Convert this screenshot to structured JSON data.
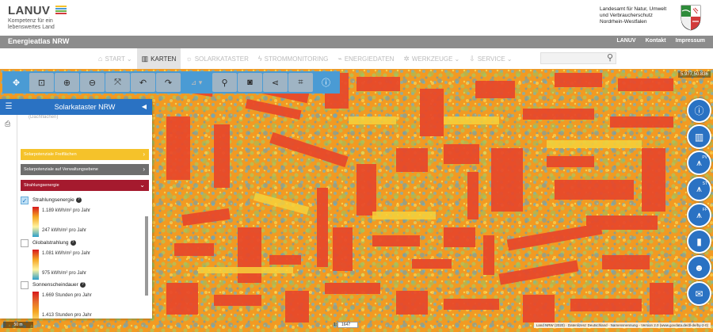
{
  "header": {
    "logo_title": "LANUV",
    "logo_subtitle": "Kompetenz für ein lebenswertes Land",
    "logo_stripe_colors": [
      "#f5c22a",
      "#4a9bd4",
      "#6ab04c",
      "#d23b3b"
    ],
    "agency_name": "Landesamt für Natur, Umwelt und Verbraucherschutz Nordrhein-Westfalen",
    "crest_icon": "nrw-crest-icon"
  },
  "greybar": {
    "site_title": "Energieatlas NRW",
    "links": [
      "LANUV",
      "Kontakt",
      "Impressum"
    ]
  },
  "nav": {
    "items": [
      {
        "label": "START",
        "icon": "home-icon",
        "glyph": "⌂",
        "dropdown": true,
        "active": false
      },
      {
        "label": "KARTEN",
        "icon": "map-icon",
        "glyph": "▥",
        "dropdown": false,
        "active": true
      },
      {
        "label": "SOLARKATASTER",
        "icon": "sun-icon",
        "glyph": "☼",
        "dropdown": false,
        "active": false
      },
      {
        "label": "STROMMONITORING",
        "icon": "bolt-icon",
        "glyph": "ϟ",
        "dropdown": false,
        "active": false
      },
      {
        "label": "ENERGIEDATEN",
        "icon": "chart-icon",
        "glyph": "⌁",
        "dropdown": false,
        "active": false
      },
      {
        "label": "WERKZEUGE",
        "icon": "cogs-icon",
        "glyph": "✲",
        "dropdown": true,
        "active": false
      },
      {
        "label": "SERVICE",
        "icon": "download-icon",
        "glyph": "⇩",
        "dropdown": true,
        "active": false
      }
    ],
    "search_placeholder": ""
  },
  "toolbar": {
    "buttons": [
      {
        "name": "pan-tool-button",
        "glyph": "✥",
        "style": "normal"
      },
      {
        "name": "zoom-box-button",
        "glyph": "⊡",
        "style": "light"
      },
      {
        "name": "zoom-in-button",
        "glyph": "⊕",
        "style": "light"
      },
      {
        "name": "zoom-out-button",
        "glyph": "⊖",
        "style": "light"
      },
      {
        "name": "full-extent-button",
        "glyph": "⤧",
        "style": "light"
      },
      {
        "name": "undo-button",
        "glyph": "↶",
        "style": "light"
      },
      {
        "name": "redo-button",
        "glyph": "↷",
        "style": "light"
      },
      {
        "name": "measure-dropdown-button",
        "glyph": "⊿ ▾",
        "style": "dd"
      },
      {
        "name": "marker-button",
        "glyph": "⚲",
        "style": "light"
      },
      {
        "name": "camera-button",
        "glyph": "◙",
        "style": "light"
      },
      {
        "name": "share-button",
        "glyph": "⋖",
        "style": "light"
      },
      {
        "name": "crop-button",
        "glyph": "⌗",
        "style": "light"
      },
      {
        "name": "info-button",
        "glyph": "ⓘ",
        "style": "normal"
      }
    ]
  },
  "panel": {
    "title": "Solarkataster NRW",
    "cut_text": "(Dachflächen)",
    "rows": [
      {
        "label": "Solarpotenziale Freiflächen",
        "chevron": "›"
      },
      {
        "label": "Solarpotenziale auf Verwaltungsebene",
        "chevron": "›"
      },
      {
        "label": "Strahlungsenergie",
        "chevron": "⌄"
      }
    ],
    "layers": [
      {
        "name": "Strahlungsenergie",
        "checked": true,
        "hi": "1.189 kWh/m² pro Jahr",
        "lo": "247 kWh/m² pro Jahr",
        "gradient": [
          "#d7191c",
          "#f5a623",
          "#fef3a0",
          "#2c9ec9"
        ]
      },
      {
        "name": "Globalstrahlung",
        "checked": false,
        "hi": "1.081 kWh/m² pro Jahr",
        "lo": "975 kWh/m² pro Jahr",
        "gradient": [
          "#d7191c",
          "#f5a623",
          "#fef3a0",
          "#2c9ec9"
        ]
      },
      {
        "name": "Sonnenscheindauer",
        "checked": false,
        "hi": "1.669 Stunden pro Jahr",
        "lo": "1.413 Stunden pro Jahr",
        "gradient": [
          "#d7191c",
          "#e66a2c",
          "#f5a623",
          "#fde27a"
        ]
      }
    ]
  },
  "map": {
    "coordinate_readout": "5.977,50.836",
    "attribution": "Land NRW (2020) · Datenlizenz Deutschland - Namensnennung - Version 2.0 (www.govdata.de/dl-de/by-2-0)",
    "scale_left": "50 m",
    "scale_prefix": "1:",
    "scale_value": "1647"
  },
  "right_buttons": [
    {
      "name": "info-circle-button",
      "glyph": "ⓘ",
      "sup": ""
    },
    {
      "name": "statistics-button",
      "glyph": "▥",
      "sup": ""
    },
    {
      "name": "pv-calc-button",
      "glyph": "⩚",
      "sup": "PV"
    },
    {
      "name": "st-calc-button",
      "glyph": "⩚",
      "sup": "ST"
    },
    {
      "name": "ff-calc-button",
      "glyph": "⩚",
      "sup": "FF"
    },
    {
      "name": "battery-button",
      "glyph": "▮",
      "sup": ""
    },
    {
      "name": "users-button",
      "glyph": "☻",
      "sup": ""
    },
    {
      "name": "chat-button",
      "glyph": "✉",
      "sup": ""
    }
  ]
}
